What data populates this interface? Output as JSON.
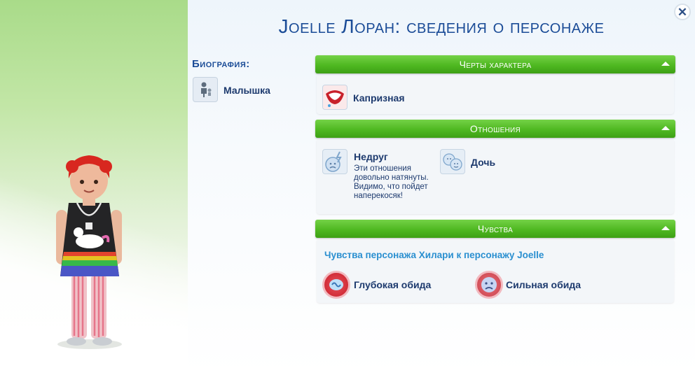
{
  "title": "Joelle Лоран: сведения о персонаже",
  "close_icon": "close-icon",
  "biography": {
    "label": "Биография:",
    "items": [
      {
        "label": "Малышка",
        "icon": "toddler-age-icon"
      }
    ]
  },
  "sections": {
    "traits": {
      "header": "Черты характера",
      "items": [
        {
          "label": "Капризная",
          "icon": "angry-mouth-trait-icon"
        }
      ]
    },
    "relationships": {
      "header": "Отношения",
      "items": [
        {
          "label": "Недруг",
          "description": "Эти отношения довольно натянуты. Видимо, что пойдет наперекосяк!",
          "icon": "disliked-face-icon"
        },
        {
          "label": "Дочь",
          "icon": "family-faces-icon"
        }
      ]
    },
    "feelings": {
      "header": "Чувства",
      "subtitle": "Чувства персонажа Хилари к персонажу Joelle",
      "items": [
        {
          "label": "Глубокая обида",
          "icon": "deep-hurt-icon"
        },
        {
          "label": "Сильная обида",
          "icon": "sad-face-icon"
        }
      ]
    }
  },
  "colors": {
    "accent_green": "#4fb821",
    "title_blue": "#1b4c97",
    "feelings_blue": "#2a8fd0"
  }
}
